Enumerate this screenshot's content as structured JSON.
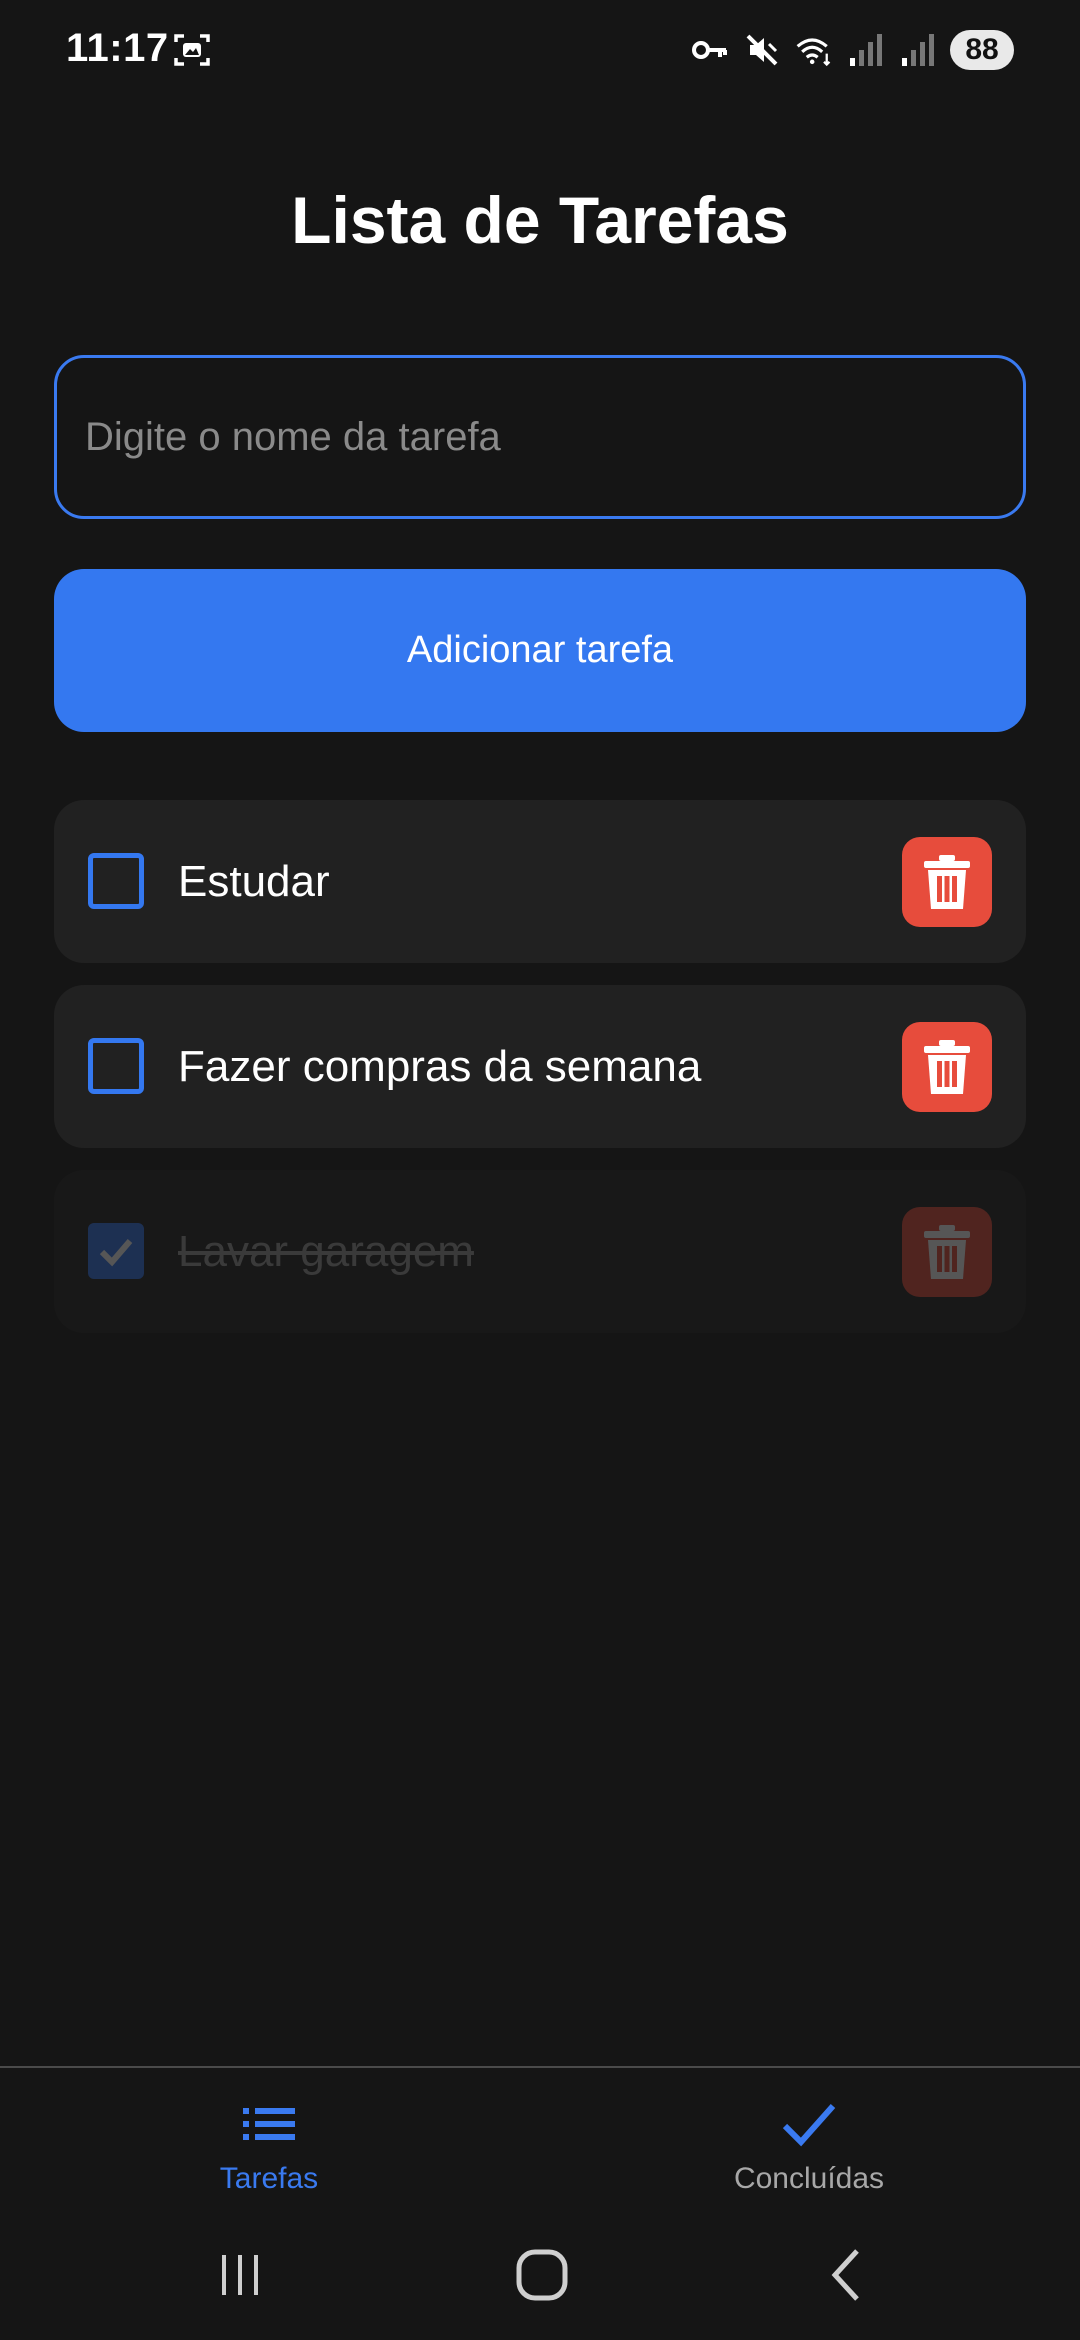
{
  "status_bar": {
    "time": "11:17",
    "battery": "88",
    "icons": [
      "screenshot-icon",
      "vpn-key-icon",
      "mute-icon",
      "wifi-icon",
      "signal-icon",
      "signal-icon"
    ]
  },
  "page": {
    "title": "Lista de Tarefas"
  },
  "input": {
    "value": "",
    "placeholder": "Digite o nome da tarefa"
  },
  "add_button": {
    "label": "Adicionar tarefa"
  },
  "tasks": [
    {
      "label": "Estudar",
      "done": false
    },
    {
      "label": "Fazer compras da semana",
      "done": false
    },
    {
      "label": "Lavar garagem",
      "done": true
    }
  ],
  "bottom_nav": {
    "items": [
      {
        "label": "Tarefas",
        "icon": "list-icon",
        "active": true
      },
      {
        "label": "Concluídas",
        "icon": "check-icon",
        "active": false
      }
    ]
  },
  "colors": {
    "background": "#151515",
    "accent": "#3478f0",
    "danger": "#e74c3c",
    "card": "#212121"
  }
}
